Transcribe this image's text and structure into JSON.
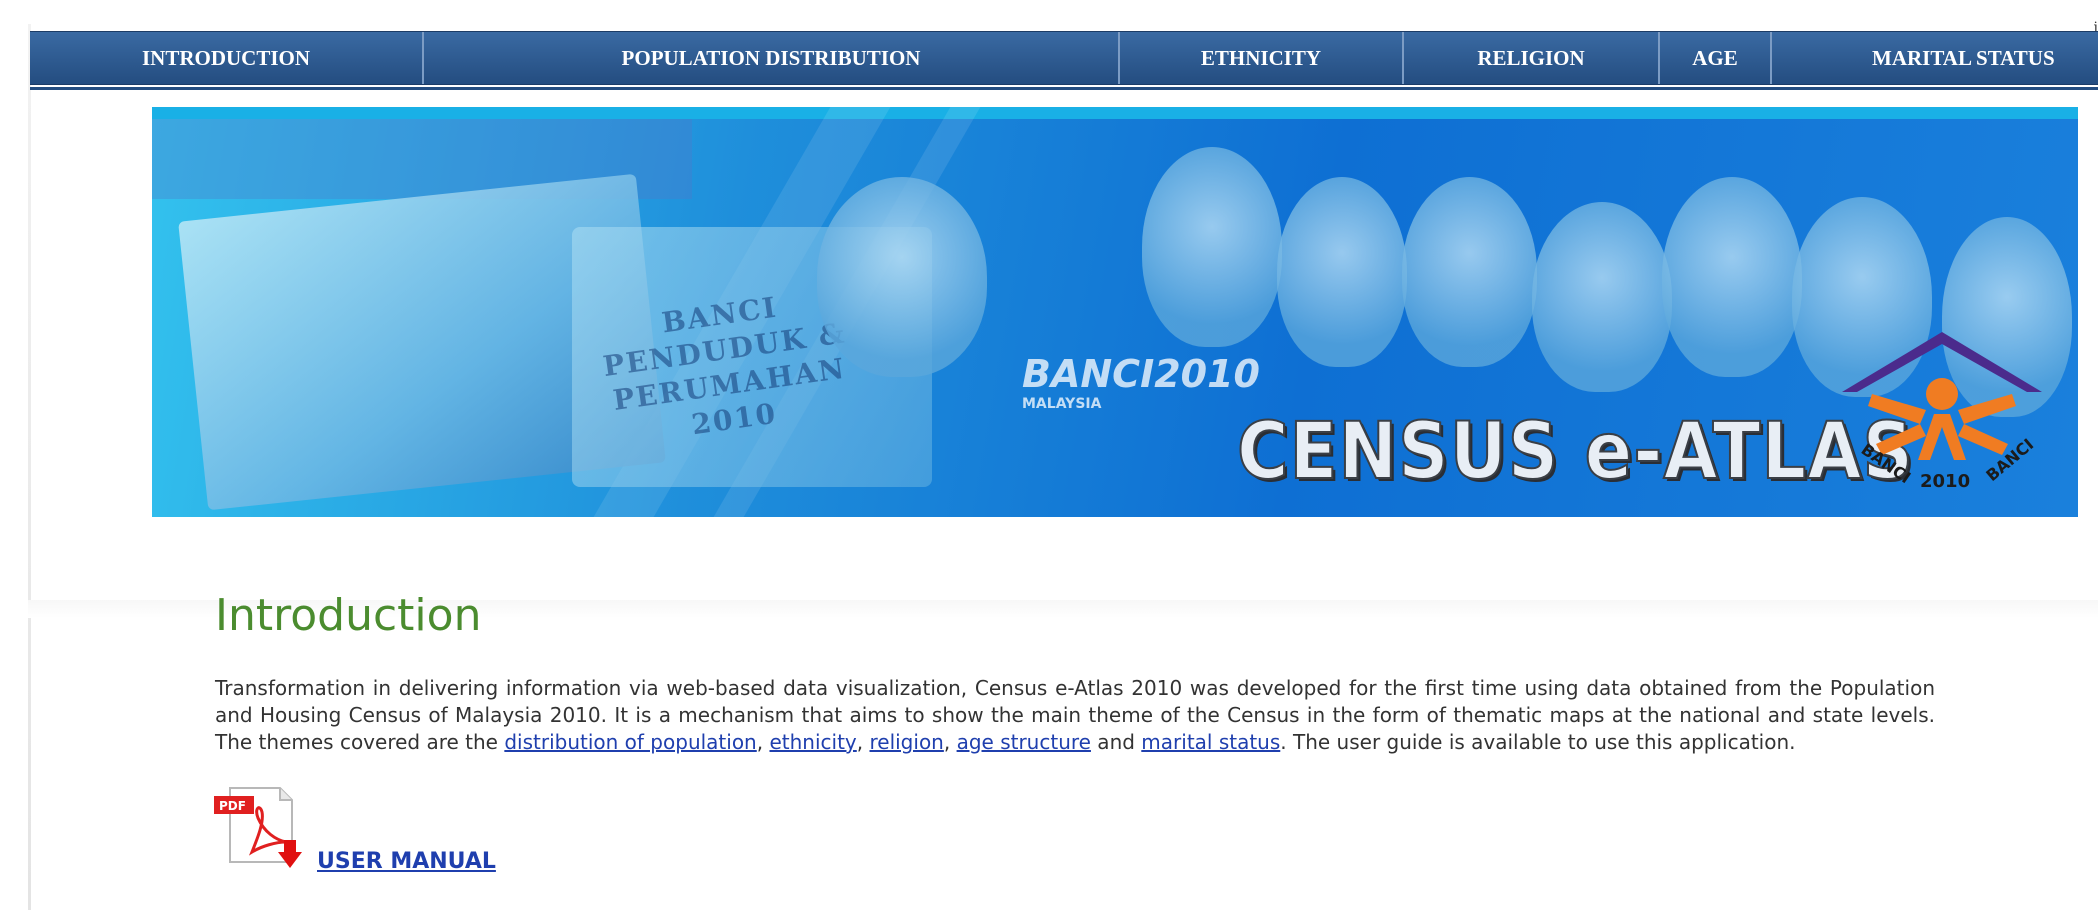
{
  "nav": {
    "items": [
      {
        "label": "INTRODUCTION"
      },
      {
        "label": "POPULATION DISTRIBUTION"
      },
      {
        "label": "ETHNICITY"
      },
      {
        "label": "RELIGION"
      },
      {
        "label": "AGE"
      },
      {
        "label": "MARITAL STATUS"
      }
    ],
    "color": "#2a5589"
  },
  "banner": {
    "title": "CENSUS e-ATLAS",
    "book_text": "BANCI PENDUDUK & PERUMAHAN 2010",
    "banci_mark": "BANCI2010",
    "banci_sub": "MALAYSIA",
    "logo": {
      "left": "BANCI",
      "right": "BANCI",
      "year": "2010"
    }
  },
  "intro": {
    "title": "Introduction",
    "text_1": "Transformation in delivering information via web-based data visualization, Census e-Atlas 2010 was developed for the first time using data obtained from the Population and Housing Census of Malaysia 2010. It is a mechanism that aims to show the main theme of the Census in the form of thematic maps at the national and state levels. The themes covered are the ",
    "link_population": "distribution of population",
    "sep_1": ", ",
    "link_ethnicity": "ethnicity",
    "sep_2": ", ",
    "link_religion": "religion",
    "sep_3": ", ",
    "link_age": "age structure",
    "sep_4": " and ",
    "link_marital": "marital status",
    "text_2": ". The user guide is available to use this application."
  },
  "manual": {
    "pdf_label": "PDF",
    "link_label": "USER MANUAL"
  },
  "colors": {
    "title_green": "#4b8c2f",
    "link_blue": "#1f3fae",
    "logo_orange": "#f07c22",
    "logo_purple": "#4b2b8c"
  }
}
